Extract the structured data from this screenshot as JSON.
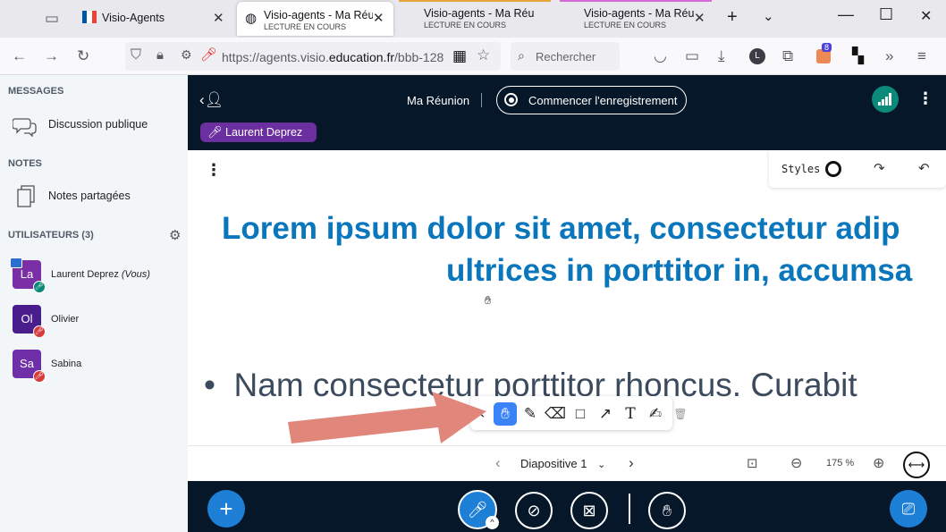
{
  "browser": {
    "tabs": [
      {
        "title": "Visio-Agents",
        "subtitle": ""
      },
      {
        "title": "Visio-agents - Ma Réunion",
        "subtitle": "LECTURE EN COURS"
      },
      {
        "title": "Visio-agents - Ma Réunion",
        "subtitle": "LECTURE EN COURS"
      },
      {
        "title": "Visio-agents - Ma Réunion",
        "subtitle": "LECTURE EN COURS"
      }
    ],
    "url_prefix": "https://agents.visio.",
    "url_domain": "education.fr",
    "url_suffix": "/bbb-128",
    "search_placeholder": "Rechercher",
    "extension_badge": "8"
  },
  "sidebar": {
    "messages_title": "MESSAGES",
    "public_chat": "Discussion publique",
    "notes_title": "NOTES",
    "shared_notes": "Notes partagées",
    "users_title": "UTILISATEURS (3)",
    "users": [
      {
        "initials": "La",
        "name": "Laurent Deprez",
        "suffix": "(Vous)",
        "color": "#7b2fa6"
      },
      {
        "initials": "Ol",
        "name": "Olivier",
        "suffix": "",
        "color": "#4a1d8c"
      },
      {
        "initials": "Sa",
        "name": "Sabina",
        "suffix": "",
        "color": "#6f2fa8"
      }
    ]
  },
  "meeting": {
    "title": "Ma Réunion",
    "record_label": "Commencer l'enregistrement",
    "talking": "Laurent Deprez"
  },
  "board": {
    "styles_label": "Styles",
    "title_line1": "Lorem ipsum dolor sit amet, consectetur adip",
    "title_line2": "ultrices in porttitor in, accumsa",
    "bullet": "Nam consectetur porttitor rhoncus. Curabit"
  },
  "slidebar": {
    "slide_label": "Diapositive 1",
    "zoom": "175 %"
  },
  "colors": {
    "accent_blue": "#0a76bc",
    "header_bg": "#06172a",
    "control_blue": "#1e7fd6",
    "connection_green": "#0b8a7a",
    "arrow_salmon": "#e0867a"
  }
}
